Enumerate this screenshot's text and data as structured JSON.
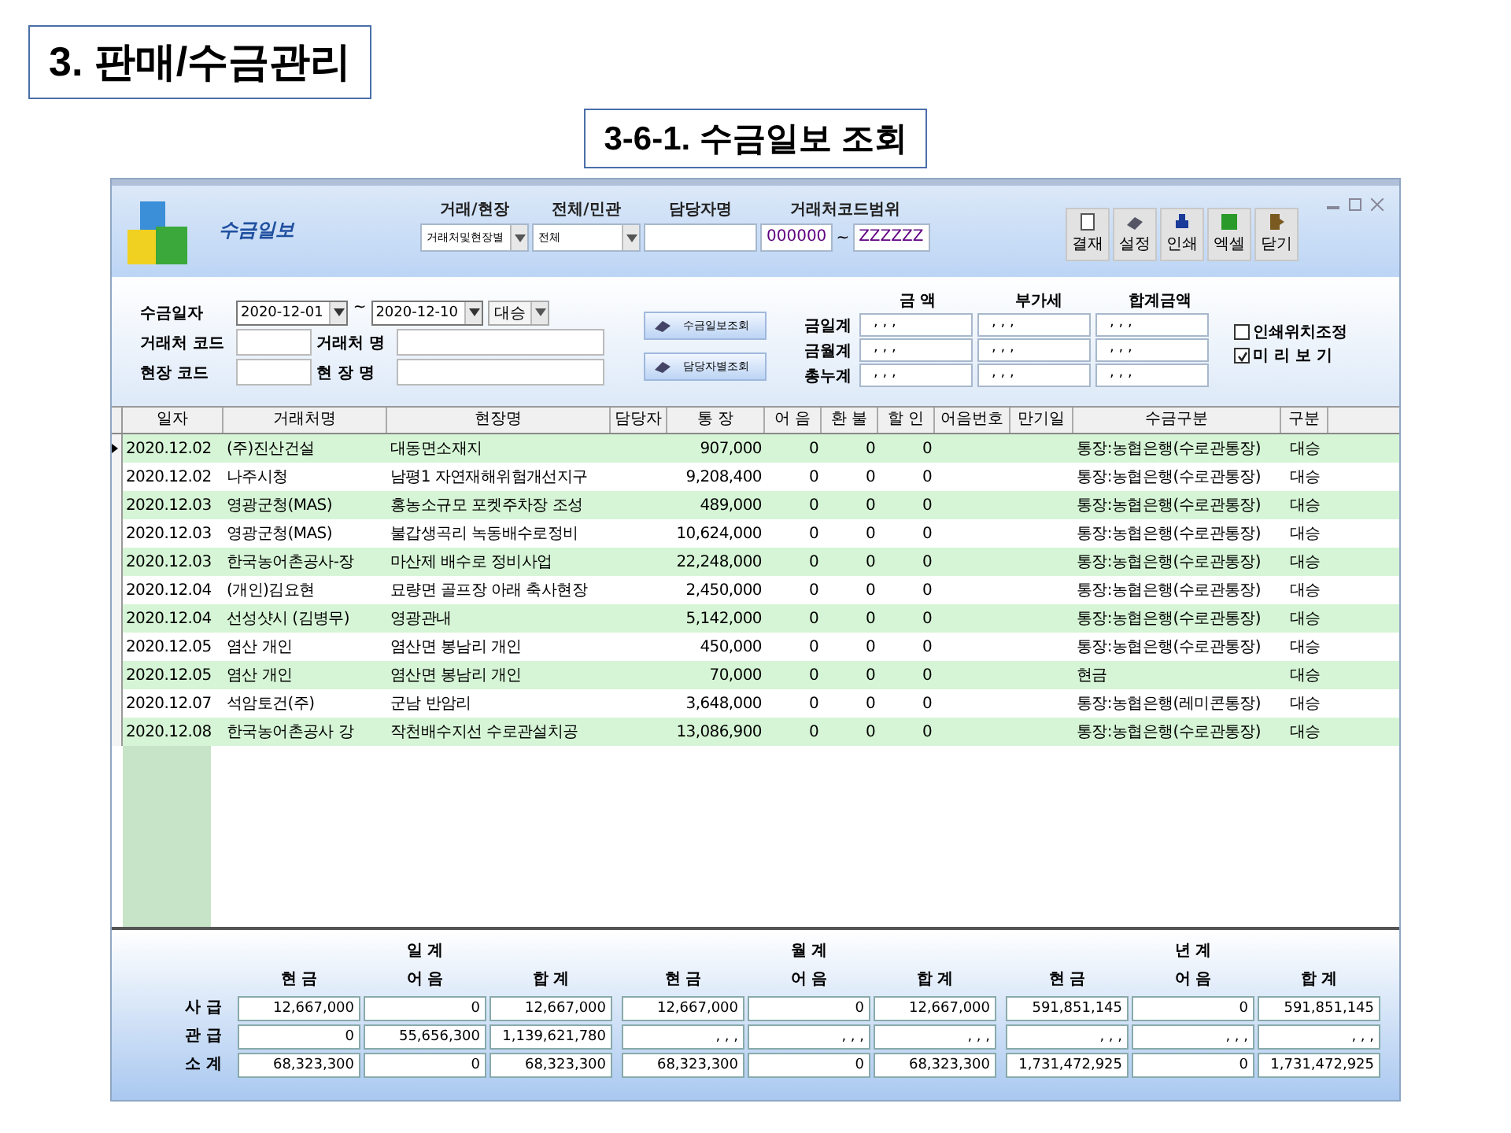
{
  "slide": {
    "title": "3. 판매/수금관리",
    "subtitle": "3-6-1. 수금일보 조회"
  },
  "window": {
    "title": "수금일보"
  },
  "filters": [
    {
      "label": "거래/현장",
      "kind": "select",
      "value": "거래처및현장별"
    },
    {
      "label": "전체/민관",
      "kind": "select",
      "value": "전체"
    },
    {
      "label": "담당자명",
      "kind": "input"
    },
    {
      "label": "거래처코드범위",
      "kind": "range",
      "from": "000000",
      "sep": "~",
      "to": "ZZZZZZ"
    }
  ],
  "toolbar": [
    "결재",
    "설정",
    "인쇄",
    "엑셀",
    "닫기"
  ],
  "query": {
    "date_label": "수금일자",
    "date_from": "2020-12-01",
    "date_sep": "~",
    "date_to": "2020-12-10",
    "branch": "대승",
    "field_rows": [
      {
        "code_label": "거래처 코드",
        "name_label": "거래처 명"
      },
      {
        "code_label": "현장 코드",
        "name_label": "현 장 명"
      }
    ],
    "buttons": [
      "수금일보조회",
      "담당자별조회"
    ]
  },
  "summary": {
    "columns": [
      "금 액",
      "부가세",
      "합계금액"
    ],
    "rows": [
      {
        "label": "금일계",
        "values": [
          ", , ,",
          ", , ,",
          ", , ,"
        ]
      },
      {
        "label": "금월계",
        "values": [
          ", , ,",
          ", , ,",
          ", , ,"
        ]
      },
      {
        "label": "총누계",
        "values": [
          ", , ,",
          ", , ,",
          ", , ,"
        ]
      }
    ]
  },
  "options": [
    {
      "label": "인쇄위치조정",
      "checked": false
    },
    {
      "label": "미 리 보 기",
      "checked": true
    }
  ],
  "table": {
    "columns": [
      "일자",
      "거래처명",
      "현장명",
      "담당자",
      "통 장",
      "어 음",
      "환 불",
      "할 인",
      "어음번호",
      "만기일",
      "수금구분",
      "구분"
    ],
    "rows": [
      {
        "selected": true,
        "date": "2020.12.02",
        "client": "(주)진산건설",
        "site": "대동면소재지",
        "bank": "907,000",
        "note": "0",
        "refund": "0",
        "discount": "0",
        "method": "통장:농협은행(수로관통장)",
        "type": "대승"
      },
      {
        "selected": false,
        "date": "2020.12.02",
        "client": "나주시청",
        "site": "남평1 자연재해위험개선지구",
        "bank": "9,208,400",
        "note": "0",
        "refund": "0",
        "discount": "0",
        "method": "통장:농협은행(수로관통장)",
        "type": "대승"
      },
      {
        "selected": false,
        "date": "2020.12.03",
        "client": "영광군청(MAS)",
        "site": "홍농소규모 포켓주차장 조성",
        "bank": "489,000",
        "note": "0",
        "refund": "0",
        "discount": "0",
        "method": "통장:농협은행(수로관통장)",
        "type": "대승"
      },
      {
        "selected": false,
        "date": "2020.12.03",
        "client": "영광군청(MAS)",
        "site": "불갑생곡리 녹동배수로정비",
        "bank": "10,624,000",
        "note": "0",
        "refund": "0",
        "discount": "0",
        "method": "통장:농협은행(수로관통장)",
        "type": "대승"
      },
      {
        "selected": false,
        "date": "2020.12.03",
        "client": "한국농어촌공사-장",
        "site": "마산제 배수로 정비사업",
        "bank": "22,248,000",
        "note": "0",
        "refund": "0",
        "discount": "0",
        "method": "통장:농협은행(수로관통장)",
        "type": "대승"
      },
      {
        "selected": false,
        "date": "2020.12.04",
        "client": "(개인)김요현",
        "site": "묘량면 골프장 아래 축사현장",
        "bank": "2,450,000",
        "note": "0",
        "refund": "0",
        "discount": "0",
        "method": "통장:농협은행(수로관통장)",
        "type": "대승"
      },
      {
        "selected": false,
        "date": "2020.12.04",
        "client": "선성샷시 (김병무)",
        "site": "영광관내",
        "bank": "5,142,000",
        "note": "0",
        "refund": "0",
        "discount": "0",
        "method": "통장:농협은행(수로관통장)",
        "type": "대승"
      },
      {
        "selected": false,
        "date": "2020.12.05",
        "client": "염산 개인",
        "site": "염산면 봉남리 개인",
        "bank": "450,000",
        "note": "0",
        "refund": "0",
        "discount": "0",
        "method": "통장:농협은행(수로관통장)",
        "type": "대승"
      },
      {
        "selected": false,
        "date": "2020.12.05",
        "client": "염산 개인",
        "site": "염산면 봉남리 개인",
        "bank": "70,000",
        "note": "0",
        "refund": "0",
        "discount": "0",
        "method": "현금",
        "type": "대승"
      },
      {
        "selected": false,
        "date": "2020.12.07",
        "client": "석암토건(주)",
        "site": "군남 반암리",
        "bank": "3,648,000",
        "note": "0",
        "refund": "0",
        "discount": "0",
        "method": "통장:농협은행(레미콘통장)",
        "type": "대승"
      },
      {
        "selected": false,
        "date": "2020.12.08",
        "client": "한국농어촌공사 강",
        "site": "작천배수지선 수로관설치공",
        "bank": "13,086,900",
        "note": "0",
        "refund": "0",
        "discount": "0",
        "method": "통장:농협은행(수로관통장)",
        "type": "대승"
      }
    ]
  },
  "totals": {
    "row_labels": [
      "사 급",
      "관 급",
      "소 계"
    ],
    "groups": [
      {
        "title": "일 계",
        "columns": [
          "현 금",
          "어 음",
          "합 계"
        ],
        "rows": [
          [
            "12,667,000",
            "0",
            "12,667,000"
          ],
          [
            "0",
            "55,656,300",
            "1,139,621,780"
          ],
          [
            "68,323,300",
            "0",
            "68,323,300"
          ]
        ]
      },
      {
        "title": "월 계",
        "columns": [
          "현 금",
          "어 음",
          "합 계"
        ],
        "rows": [
          [
            "12,667,000",
            "0",
            "12,667,000"
          ],
          [
            ", , ,",
            ", , ,",
            ", , ,"
          ],
          [
            "68,323,300",
            "0",
            "68,323,300"
          ]
        ]
      },
      {
        "title": "년 계",
        "columns": [
          "현 금",
          "어 음",
          "합 계"
        ],
        "rows": [
          [
            "591,851,145",
            "0",
            "591,851,145"
          ],
          [
            ", , ,",
            ", , ,",
            ", , ,"
          ],
          [
            "1,731,472,925",
            "0",
            "1,731,472,925"
          ]
        ]
      }
    ]
  }
}
